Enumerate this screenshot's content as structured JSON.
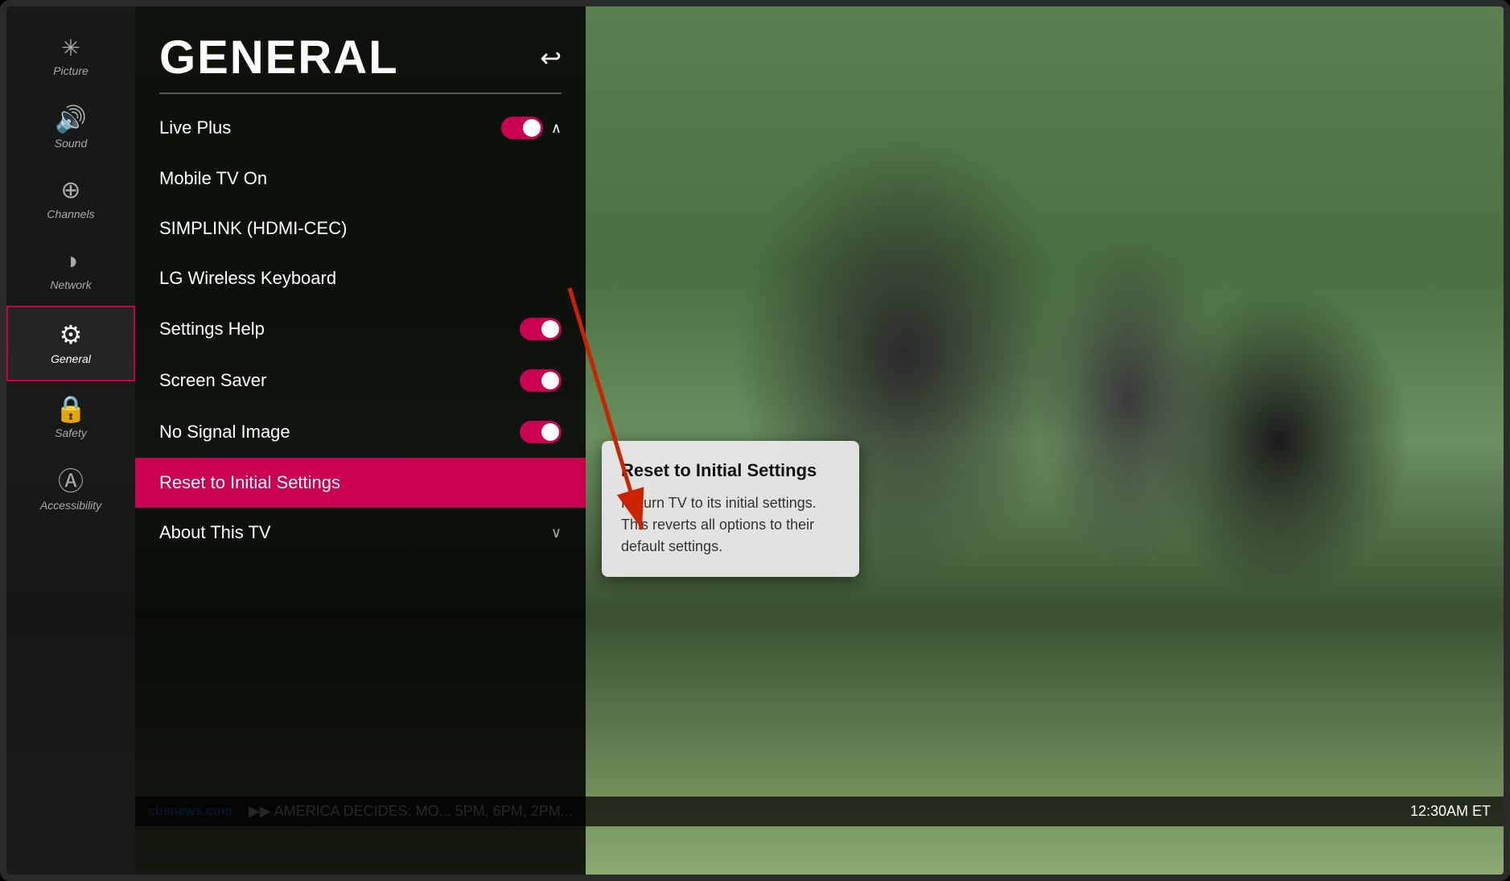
{
  "sidebar": {
    "items": [
      {
        "id": "picture",
        "label": "Picture",
        "icon": "✳"
      },
      {
        "id": "sound",
        "label": "Sound",
        "icon": "🔊"
      },
      {
        "id": "channels",
        "label": "Channels",
        "icon": "⊕"
      },
      {
        "id": "network",
        "label": "Network",
        "icon": "◑"
      },
      {
        "id": "general",
        "label": "General",
        "icon": "⚙",
        "active": true
      },
      {
        "id": "safety",
        "label": "Safety",
        "icon": "🔒"
      },
      {
        "id": "accessibility",
        "label": "Accessibility",
        "icon": "♿"
      }
    ]
  },
  "panel": {
    "title": "GENERAL",
    "back_icon": "↩"
  },
  "menu": {
    "items": [
      {
        "label": "Live Plus",
        "toggle": true,
        "toggle_on": true,
        "show_chevron_up": true
      },
      {
        "label": "Mobile TV On",
        "toggle": false
      },
      {
        "label": "SIMPLINK (HDMI-CEC)",
        "toggle": false
      },
      {
        "label": "LG Wireless Keyboard",
        "toggle": false
      },
      {
        "label": "Settings Help",
        "toggle": true,
        "toggle_on": true
      },
      {
        "label": "Screen Saver",
        "toggle": true,
        "toggle_on": true
      },
      {
        "label": "No Signal Image",
        "toggle": true,
        "toggle_on": true
      },
      {
        "label": "Reset to Initial Settings",
        "active": true
      },
      {
        "label": "About This TV",
        "show_chevron_down": true
      }
    ]
  },
  "tooltip": {
    "title": "Reset to Initial Settings",
    "body": "Return TV to its initial settings. This reverts all options to their default settings."
  },
  "news_ticker": {
    "logo": "cbsnews.com",
    "text": "▶▶ AMERICA DECIDES: MO... 5PM, 6PM, 2PM...",
    "time": "12:30AM ET"
  }
}
